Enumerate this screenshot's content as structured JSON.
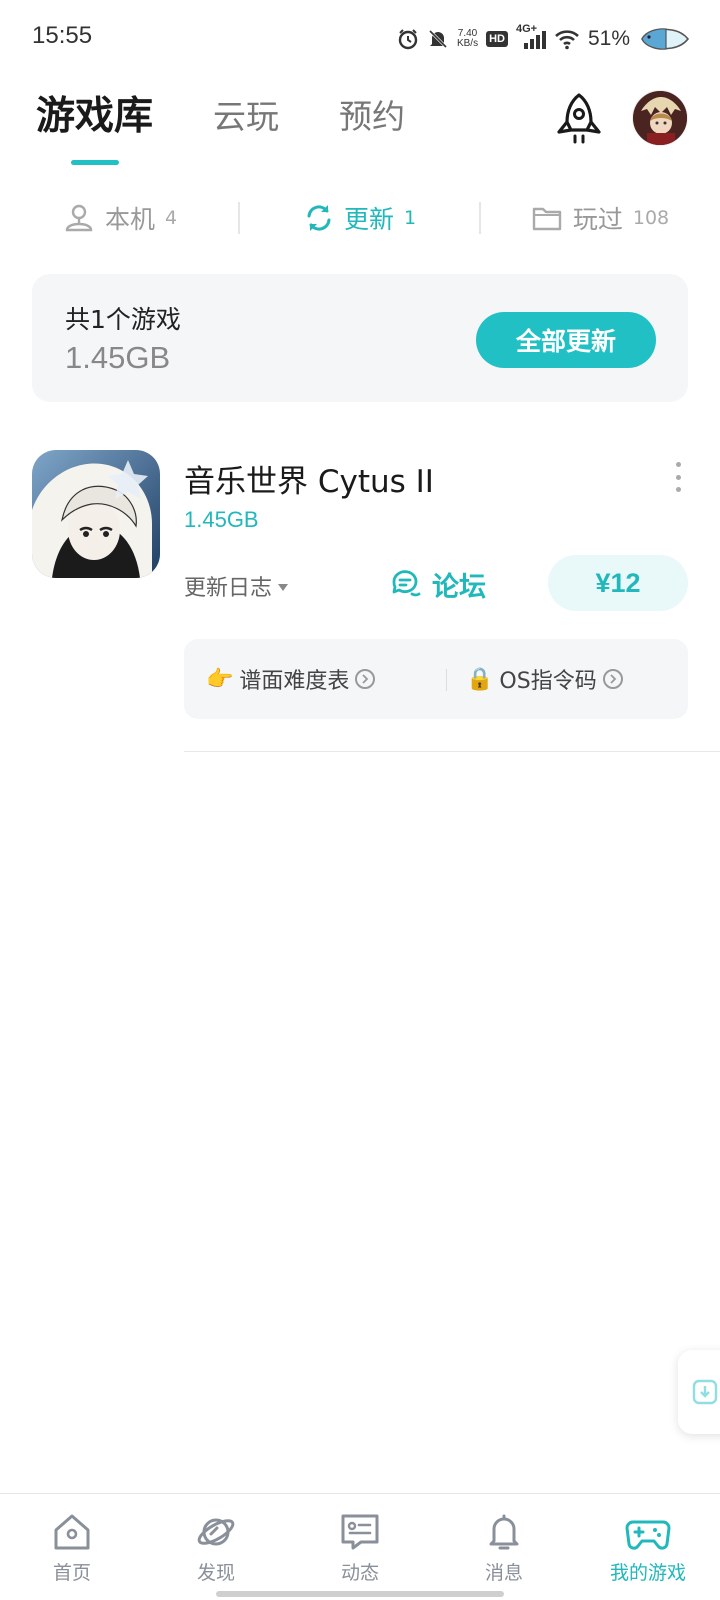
{
  "status_bar": {
    "time": "15:55",
    "net_speed_value": "7.40",
    "net_speed_unit": "KB/s",
    "hd_label": "HD",
    "network": "4G+",
    "battery_percent": "51%",
    "icons": [
      "alarm-icon",
      "mute-bell-icon",
      "signal-icon",
      "wifi-icon",
      "battery-icon"
    ]
  },
  "header": {
    "tabs": [
      {
        "label": "游戏库",
        "active": true
      },
      {
        "label": "云玩",
        "active": false
      },
      {
        "label": "预约",
        "active": false
      }
    ],
    "rocket_icon": "rocket-icon",
    "avatar": "user-avatar"
  },
  "sub_tabs": [
    {
      "icon": "device-icon",
      "label": "本机",
      "count": "4",
      "active": false
    },
    {
      "icon": "refresh-icon",
      "label": "更新",
      "count": "1",
      "active": true
    },
    {
      "icon": "folder-icon",
      "label": "玩过",
      "count": "108",
      "active": false
    }
  ],
  "summary": {
    "count_text": "共1个游戏",
    "size_text": "1.45GB",
    "update_all_label": "全部更新"
  },
  "game": {
    "title": "音乐世界 Cytus II",
    "size": "1.45GB",
    "changelog_label": "更新日志",
    "forum_label": "论坛",
    "price": "¥12",
    "links": [
      {
        "emoji": "👉",
        "label": "谱面难度表"
      },
      {
        "emoji": "🔒",
        "label": "OS指令码"
      }
    ]
  },
  "bottom_nav": [
    {
      "icon": "home-icon",
      "label": "首页",
      "active": false
    },
    {
      "icon": "planet-icon",
      "label": "发现",
      "active": false
    },
    {
      "icon": "chat-card-icon",
      "label": "动态",
      "active": false
    },
    {
      "icon": "bell-icon",
      "label": "消息",
      "active": false
    },
    {
      "icon": "gamepad-icon",
      "label": "我的游戏",
      "active": true
    }
  ],
  "colors": {
    "accent": "#21c0c4",
    "accent_text": "#21b8bc",
    "card_bg": "#f4f6f8"
  }
}
